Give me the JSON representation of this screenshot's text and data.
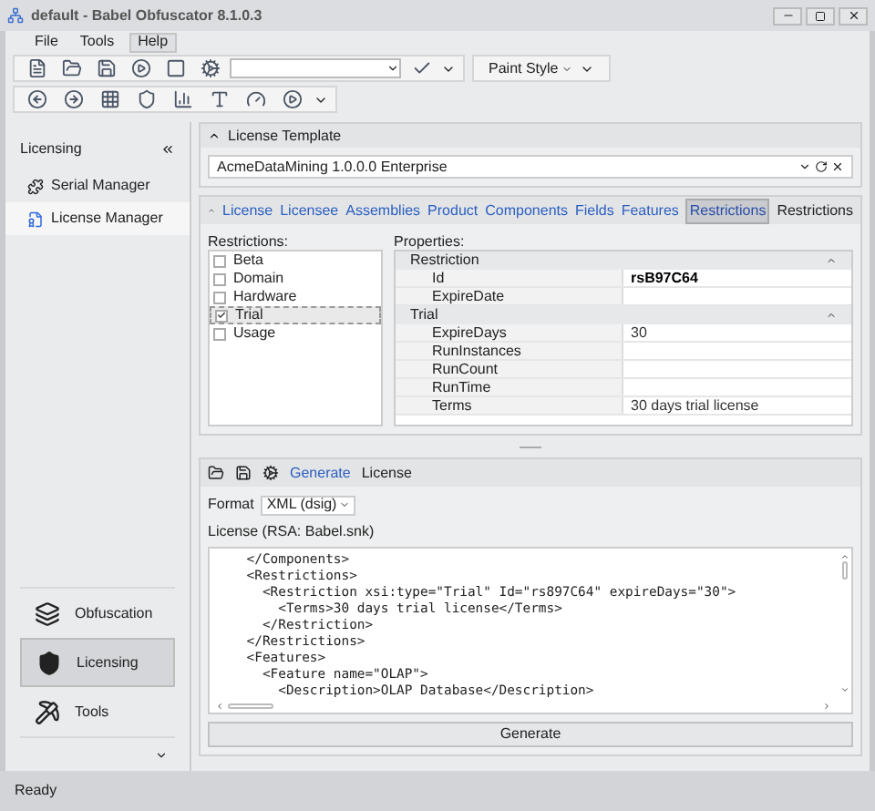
{
  "window": {
    "title": "default -  Babel Obfuscator 8.1.0.3"
  },
  "menu": [
    {
      "label": "File",
      "selected": false
    },
    {
      "label": "Tools",
      "selected": false
    },
    {
      "label": "Help",
      "selected": true
    }
  ],
  "toolbar": {
    "paint_style": "Paint Style"
  },
  "sidebar": {
    "header": "Licensing",
    "items": [
      {
        "label": "Serial Manager",
        "selected": false,
        "kind": "puzzle"
      },
      {
        "label": "License Manager",
        "selected": true,
        "kind": "license"
      }
    ],
    "nav": [
      {
        "label": "Obfuscation",
        "selected": false,
        "kind": "layers"
      },
      {
        "label": "Licensing",
        "selected": true,
        "kind": "shield"
      },
      {
        "label": "Tools",
        "selected": false,
        "kind": "pick"
      }
    ]
  },
  "license_template": {
    "title": "License Template",
    "value": "AcmeDataMining 1.0.0.0 Enterprise"
  },
  "tabs": [
    {
      "label": "License",
      "selected": false
    },
    {
      "label": "Licensee",
      "selected": false
    },
    {
      "label": "Assemblies",
      "selected": false
    },
    {
      "label": "Product",
      "selected": false
    },
    {
      "label": "Components",
      "selected": false
    },
    {
      "label": "Fields",
      "selected": false
    },
    {
      "label": "Features",
      "selected": false
    },
    {
      "label": "Restrictions",
      "selected": true
    }
  ],
  "tab_caption": "Restrictions",
  "restrictions": {
    "label": "Restrictions:",
    "items": [
      {
        "label": "Beta",
        "checked": false,
        "selected": false
      },
      {
        "label": "Domain",
        "checked": false,
        "selected": false
      },
      {
        "label": "Hardware",
        "checked": false,
        "selected": false
      },
      {
        "label": "Trial",
        "checked": true,
        "selected": true
      },
      {
        "label": "Usage",
        "checked": false,
        "selected": false
      }
    ]
  },
  "properties": {
    "label": "Properties:",
    "groups": [
      {
        "name": "Restriction",
        "expanded": true,
        "rows": [
          {
            "name": "Id",
            "value": "rsB97C64",
            "bold": true
          },
          {
            "name": "ExpireDate"
          }
        ]
      },
      {
        "name": "Trial",
        "expanded": true,
        "rows": [
          {
            "name": "ExpireDays",
            "value": "30"
          },
          {
            "name": "RunInstances"
          },
          {
            "name": "RunCount"
          },
          {
            "name": "RunTime"
          },
          {
            "name": "Terms",
            "value": "30 days trial license"
          }
        ]
      }
    ]
  },
  "generate_panel": {
    "action": "Generate",
    "title": "License",
    "format_label": "Format",
    "format_value": "XML (dsig)",
    "license_label": "License (RSA: Babel.snk)",
    "code": [
      "    </Components>",
      "    <Restrictions>",
      "      <Restriction xsi:type=\"Trial\" Id=\"rs897C64\" expireDays=\"30\">",
      "        <Terms>30 days trial license</Terms>",
      "      </Restriction>",
      "    </Restrictions>",
      "    <Features>",
      "      <Feature name=\"OLAP\">",
      "        <Description>OLAP Database</Description>"
    ],
    "button": "Generate"
  },
  "status_bar": {
    "text": "Ready"
  }
}
